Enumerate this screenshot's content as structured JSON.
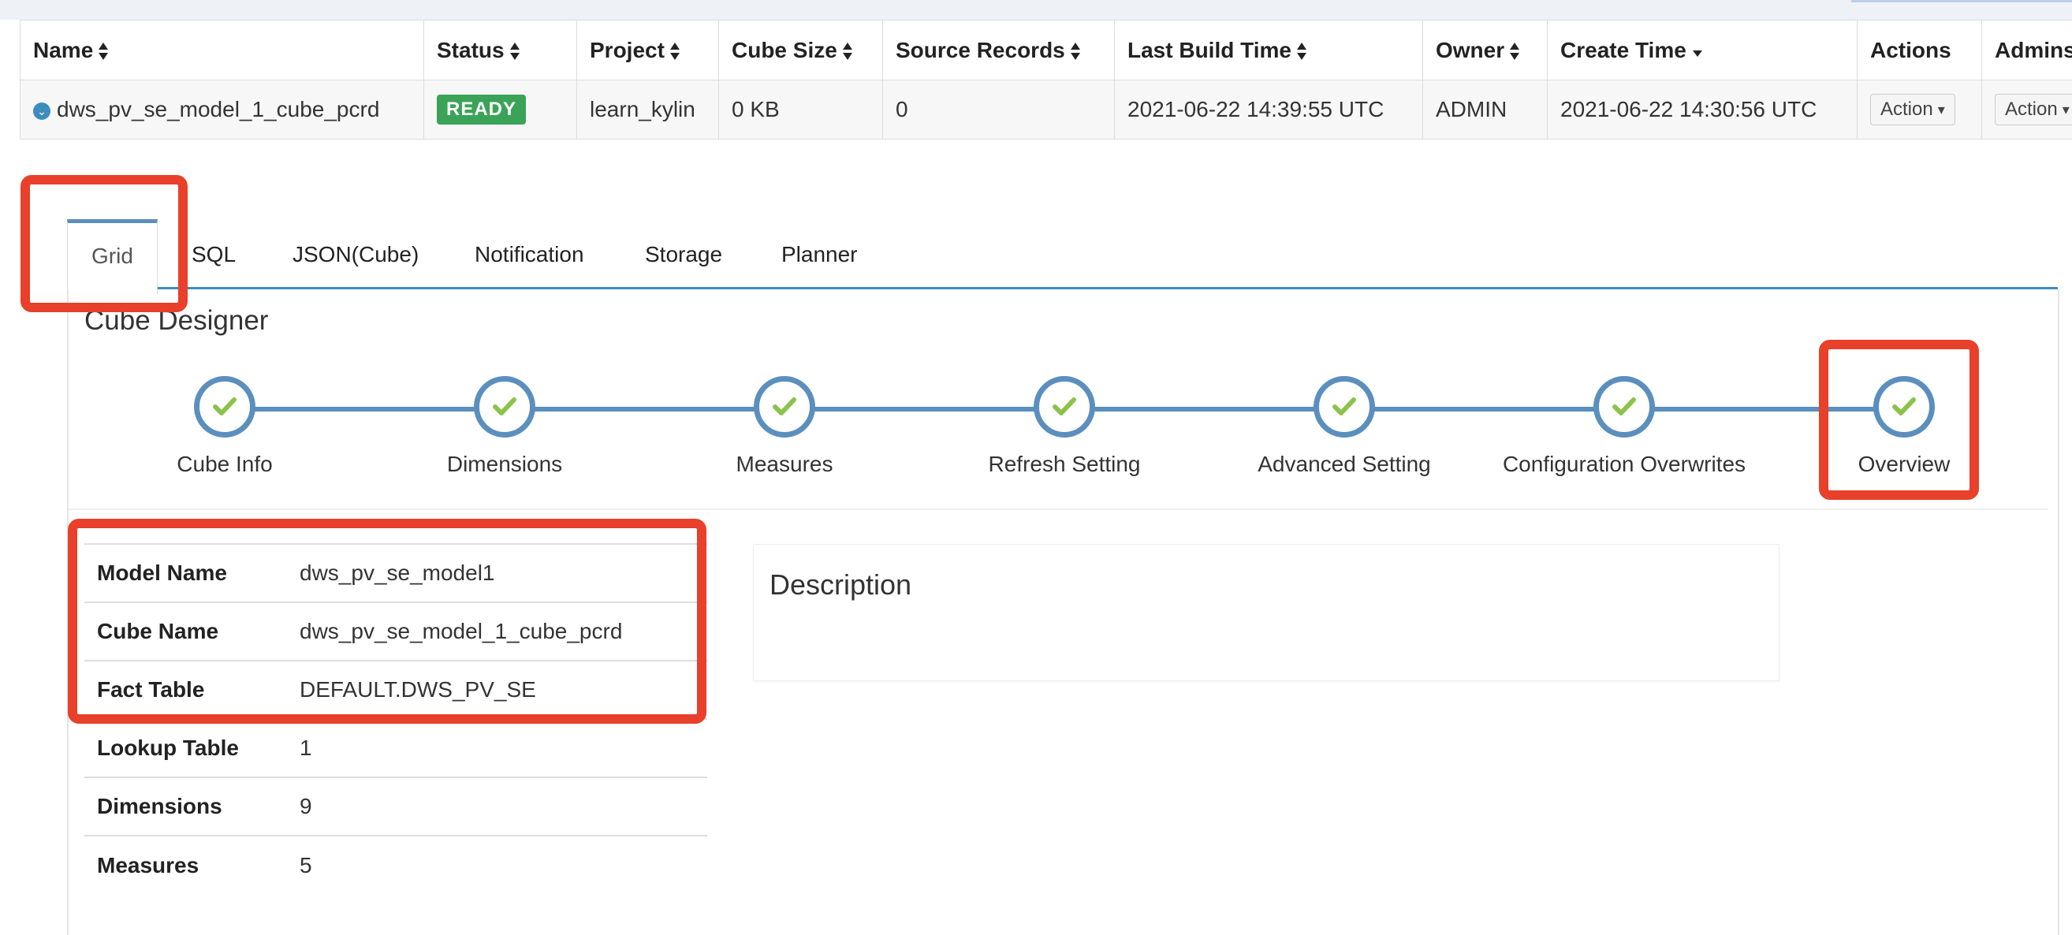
{
  "table": {
    "headers": [
      "Name",
      "Status",
      "Project",
      "Cube Size",
      "Source Records",
      "Last Build Time",
      "Owner",
      "Create Time",
      "Actions",
      "Admins"
    ],
    "row": {
      "name": "dws_pv_se_model_1_cube_pcrd",
      "status": "READY",
      "project": "learn_kylin",
      "cube_size": "0 KB",
      "source_records": "0",
      "last_build_time": "2021-06-22 14:39:55 UTC",
      "owner": "ADMIN",
      "create_time": "2021-06-22 14:30:56 UTC",
      "action_label": "Action",
      "admins_label": "Action"
    }
  },
  "tabs": [
    "Grid",
    "SQL",
    "JSON(Cube)",
    "Notification",
    "Storage",
    "Planner"
  ],
  "designer": {
    "title": "Cube Designer",
    "steps": [
      "Cube Info",
      "Dimensions",
      "Measures",
      "Refresh Setting",
      "Advanced Setting",
      "Configuration Overwrites",
      "Overview"
    ]
  },
  "overview": [
    {
      "key": "Model Name",
      "value": "dws_pv_se_model1"
    },
    {
      "key": "Cube Name",
      "value": "dws_pv_se_model_1_cube_pcrd"
    },
    {
      "key": "Fact Table",
      "value": "DEFAULT.DWS_PV_SE"
    },
    {
      "key": "Lookup Table",
      "value": "1"
    },
    {
      "key": "Dimensions",
      "value": "9"
    },
    {
      "key": "Measures",
      "value": "5"
    }
  ],
  "description": {
    "title": "Description"
  },
  "colors": {
    "accent": "#5b8fbd",
    "ready": "#3aa357",
    "check": "#8bc34a",
    "highlight": "#e8402a"
  },
  "icons": {
    "sort": "sort-icon",
    "expand": "chevron-down-circle-icon",
    "check": "check-icon",
    "caret": "caret-down-icon"
  }
}
